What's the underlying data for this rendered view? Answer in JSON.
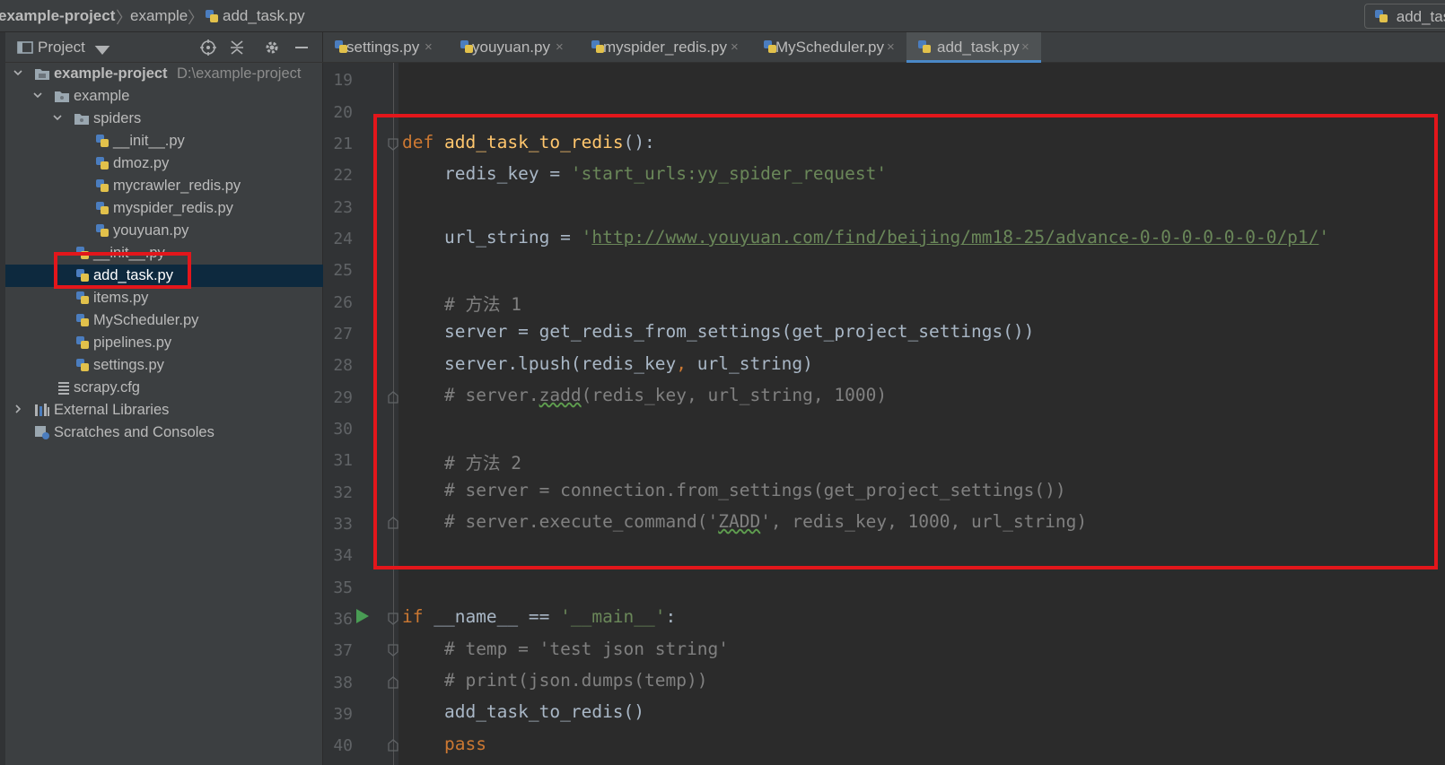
{
  "breadcrumb": {
    "project": "example-project",
    "folder": "example",
    "file": "add_task.py",
    "right_tab": "add_task.py"
  },
  "project_panel": {
    "title": "Project",
    "tree": [
      {
        "label": "example-project",
        "path": "D:\\example-project",
        "type": "project-folder"
      },
      {
        "label": "example",
        "type": "folder"
      },
      {
        "label": "spiders",
        "type": "folder"
      },
      {
        "label": "__init__.py",
        "type": "python-file"
      },
      {
        "label": "dmoz.py",
        "type": "python-file"
      },
      {
        "label": "mycrawler_redis.py",
        "type": "python-file"
      },
      {
        "label": "myspider_redis.py",
        "type": "python-file"
      },
      {
        "label": "youyuan.py",
        "type": "python-file"
      },
      {
        "label": "__init__.py",
        "type": "python-file"
      },
      {
        "label": "add_task.py",
        "type": "python-file",
        "selected": true
      },
      {
        "label": "items.py",
        "type": "python-file"
      },
      {
        "label": "MyScheduler.py",
        "type": "python-file"
      },
      {
        "label": "pipelines.py",
        "type": "python-file"
      },
      {
        "label": "settings.py",
        "type": "python-file"
      },
      {
        "label": "scrapy.cfg",
        "type": "config-file"
      },
      {
        "label": "External Libraries",
        "type": "libraries"
      },
      {
        "label": "Scratches and Consoles",
        "type": "scratches"
      }
    ]
  },
  "tabs": [
    {
      "label": "settings.py",
      "close": "×"
    },
    {
      "label": "youyuan.py",
      "close": "×"
    },
    {
      "label": "myspider_redis.py",
      "close": "×"
    },
    {
      "label": "MyScheduler.py",
      "close": "×"
    },
    {
      "label": "add_task.py",
      "close": "×",
      "active": true
    }
  ],
  "editor": {
    "lines": [
      {
        "n": "19"
      },
      {
        "n": "20"
      },
      {
        "n": "21"
      },
      {
        "n": "22"
      },
      {
        "n": "23"
      },
      {
        "n": "24"
      },
      {
        "n": "25"
      },
      {
        "n": "26"
      },
      {
        "n": "27"
      },
      {
        "n": "28"
      },
      {
        "n": "29"
      },
      {
        "n": "30"
      },
      {
        "n": "31"
      },
      {
        "n": "32"
      },
      {
        "n": "33"
      },
      {
        "n": "34"
      },
      {
        "n": "35"
      },
      {
        "n": "36"
      },
      {
        "n": "37"
      },
      {
        "n": "38"
      },
      {
        "n": "39"
      },
      {
        "n": "40"
      }
    ],
    "code": {
      "l21_kw": "def",
      "l21_fn": "add_task_to_redis",
      "l21_rest": "():",
      "l22_a": "redis_key = ",
      "l22_str": "'start_urls:yy_spider_request'",
      "l24_a": "url_string = ",
      "l24_q1": "'",
      "l24_url": "http://www.youyuan.com/find/beijing/mm18-25/advance-0-0-0-0-0-0-0/p1/",
      "l24_q2": "'",
      "l26": "# 方法 1",
      "l27": "server = get_redis_from_settings(get_project_settings())",
      "l28_a": "server.lpush(redis_key",
      "l28_comma": ",",
      "l28_b": " url_string)",
      "l29_a": "# server.",
      "l29_sq": "zadd",
      "l29_b": "(redis_key, url_string, 1000)",
      "l31": "# 方法 2",
      "l32": "# server = connection.from_settings(get_project_settings())",
      "l33_a": "# server.execute_command('",
      "l33_sq": "ZADD",
      "l33_b": "', redis_key, 1000, url_string)",
      "l36_kw": "if",
      "l36_a": " __name__ == ",
      "l36_str": "'__main__'",
      "l36_b": ":",
      "l37": "# temp = 'test json string'",
      "l38": "# print(json.dumps(temp))",
      "l39": "add_task_to_redis()",
      "l40": "pass"
    }
  },
  "colors": {
    "annotation_box": "#e3161b",
    "keyword": "#cc7832",
    "function": "#ffc66d",
    "string": "#6a8759",
    "comment": "#808080",
    "selection": "#0d293e",
    "active_tab_underline": "#4a88c7"
  }
}
